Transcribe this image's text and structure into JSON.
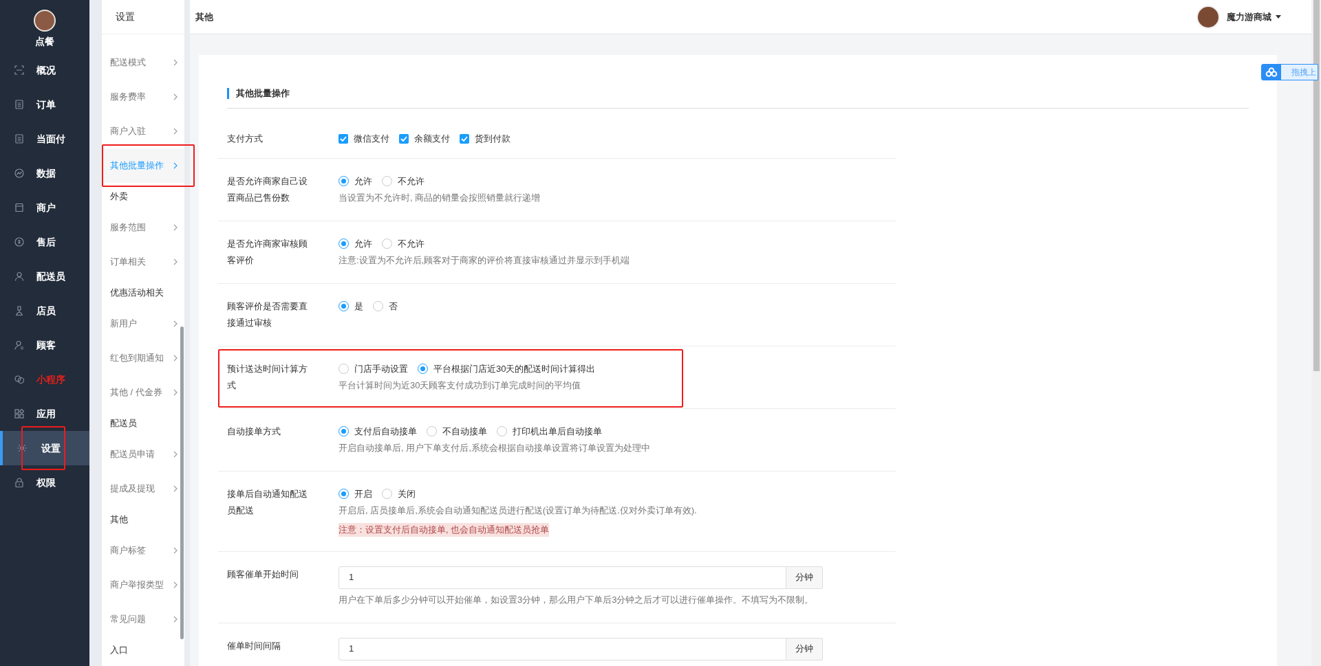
{
  "sidebar": {
    "brand": {
      "label": "点餐"
    },
    "items": [
      {
        "label": "概况",
        "kind": "normal",
        "selected": false,
        "annotated": false
      },
      {
        "label": "订单",
        "kind": "normal",
        "selected": false,
        "annotated": false
      },
      {
        "label": "当面付",
        "kind": "normal",
        "selected": false,
        "annotated": false
      },
      {
        "label": "数据",
        "kind": "normal",
        "selected": false,
        "annotated": false
      },
      {
        "label": "商户",
        "kind": "normal",
        "selected": false,
        "annotated": false
      },
      {
        "label": "售后",
        "kind": "normal",
        "selected": false,
        "annotated": false
      },
      {
        "label": "配送员",
        "kind": "normal",
        "selected": false,
        "annotated": false
      },
      {
        "label": "店员",
        "kind": "normal",
        "selected": false,
        "annotated": false
      },
      {
        "label": "顾客",
        "kind": "normal",
        "selected": false,
        "annotated": false
      },
      {
        "label": "小程序",
        "kind": "accent",
        "selected": false,
        "annotated": false
      },
      {
        "label": "应用",
        "kind": "normal",
        "selected": false,
        "annotated": false
      },
      {
        "label": "设置",
        "kind": "normal",
        "selected": true,
        "annotated": true
      },
      {
        "label": "权限",
        "kind": "normal",
        "selected": false,
        "annotated": false
      }
    ]
  },
  "submenu": {
    "title": "设置",
    "items": [
      {
        "label": "配送模式",
        "kind": "link",
        "selected": false,
        "annotated": false
      },
      {
        "label": "服务费率",
        "kind": "link",
        "selected": false,
        "annotated": false
      },
      {
        "label": "商户入驻",
        "kind": "link",
        "selected": false,
        "annotated": false
      },
      {
        "label": "其他批量操作",
        "kind": "link",
        "selected": true,
        "annotated": true
      },
      {
        "label": "外卖",
        "kind": "group",
        "selected": false,
        "annotated": false
      },
      {
        "label": "服务范围",
        "kind": "link",
        "selected": false,
        "annotated": false
      },
      {
        "label": "订单相关",
        "kind": "link",
        "selected": false,
        "annotated": false
      },
      {
        "label": "优惠活动相关",
        "kind": "group",
        "selected": false,
        "annotated": false
      },
      {
        "label": "新用户",
        "kind": "link",
        "selected": false,
        "annotated": false
      },
      {
        "label": "红包到期通知",
        "kind": "link",
        "selected": false,
        "annotated": false
      },
      {
        "label": "其他 / 代金券",
        "kind": "link",
        "selected": false,
        "annotated": false
      },
      {
        "label": "配送员",
        "kind": "group",
        "selected": false,
        "annotated": false
      },
      {
        "label": "配送员申请",
        "kind": "link",
        "selected": false,
        "annotated": false
      },
      {
        "label": "提成及提现",
        "kind": "link",
        "selected": false,
        "annotated": false
      },
      {
        "label": "其他",
        "kind": "group",
        "selected": false,
        "annotated": false
      },
      {
        "label": "商户标签",
        "kind": "link",
        "selected": false,
        "annotated": false
      },
      {
        "label": "商户举报类型",
        "kind": "link",
        "selected": false,
        "annotated": false
      },
      {
        "label": "常见问题",
        "kind": "link",
        "selected": false,
        "annotated": false
      },
      {
        "label": "入口",
        "kind": "group",
        "selected": false,
        "annotated": false
      }
    ]
  },
  "topbar": {
    "title": "其他",
    "user": "魔力游商城"
  },
  "upload_widget": {
    "label": "拖拽上"
  },
  "section": {
    "title": "其他批量操作",
    "rows": [
      {
        "kind": "checkboxes",
        "label": "支付方式",
        "annotated": false,
        "options": [
          {
            "label": "微信支付",
            "checked": true
          },
          {
            "label": "余额支付",
            "checked": true
          },
          {
            "label": "货到付款",
            "checked": true
          }
        ],
        "hints": []
      },
      {
        "kind": "radios",
        "label": "是否允许商家自己设置商品已售份数",
        "annotated": false,
        "options": [
          {
            "label": "允许",
            "selected": true
          },
          {
            "label": "不允许",
            "selected": false
          }
        ],
        "hints": [
          "当设置为不允许时, 商品的销量会按照销量就行递增"
        ]
      },
      {
        "kind": "radios",
        "label": "是否允许商家审核顾客评价",
        "annotated": false,
        "options": [
          {
            "label": "允许",
            "selected": true
          },
          {
            "label": "不允许",
            "selected": false
          }
        ],
        "hints": [
          "注意:设置为不允许后,顾客对于商家的评价将直接审核通过并显示到手机端"
        ]
      },
      {
        "kind": "radios",
        "label": "顾客评价是否需要直接通过审核",
        "annotated": false,
        "options": [
          {
            "label": "是",
            "selected": true
          },
          {
            "label": "否",
            "selected": false
          }
        ],
        "hints": []
      },
      {
        "kind": "radios",
        "label": "预计送达时间计算方式",
        "annotated": true,
        "options": [
          {
            "label": "门店手动设置",
            "selected": false
          },
          {
            "label": "平台根据门店近30天的配送时间计算得出",
            "selected": true
          }
        ],
        "hints": [
          "平台计算时间为近30天顾客支付成功到订单完成时间的平均值"
        ]
      },
      {
        "kind": "radios",
        "label": "自动接单方式",
        "annotated": false,
        "options": [
          {
            "label": "支付后自动接单",
            "selected": true
          },
          {
            "label": "不自动接单",
            "selected": false
          },
          {
            "label": "打印机出单后自动接单",
            "selected": false
          }
        ],
        "hints": [
          "开启自动接单后, 用户下单支付后,系统会根据自动接单设置将订单设置为处理中"
        ]
      },
      {
        "kind": "radios",
        "label": "接单后自动通知配送员配送",
        "annotated": false,
        "options": [
          {
            "label": "开启",
            "selected": true
          },
          {
            "label": "关闭",
            "selected": false
          }
        ],
        "hints": [
          "开启后, 店员接单后,系统会自动通知配送员进行配送(设置订单为待配送.仅对外卖订单有效)."
        ],
        "note": "注意：设置支付后自动接单, 也会自动通知配送员抢单"
      },
      {
        "kind": "input",
        "label": "顾客催单开始时间",
        "annotated": false,
        "value": "1",
        "unit": "分钟",
        "hints": [
          "用户在下单后多少分钟可以开始催单，如设置3分钟，那么用户下单后3分钟之后才可以进行催单操作。不填写为不限制。"
        ]
      },
      {
        "kind": "input",
        "label": "催单时间间隔",
        "annotated": false,
        "value": "1",
        "unit": "分钟",
        "hints": []
      }
    ]
  }
}
